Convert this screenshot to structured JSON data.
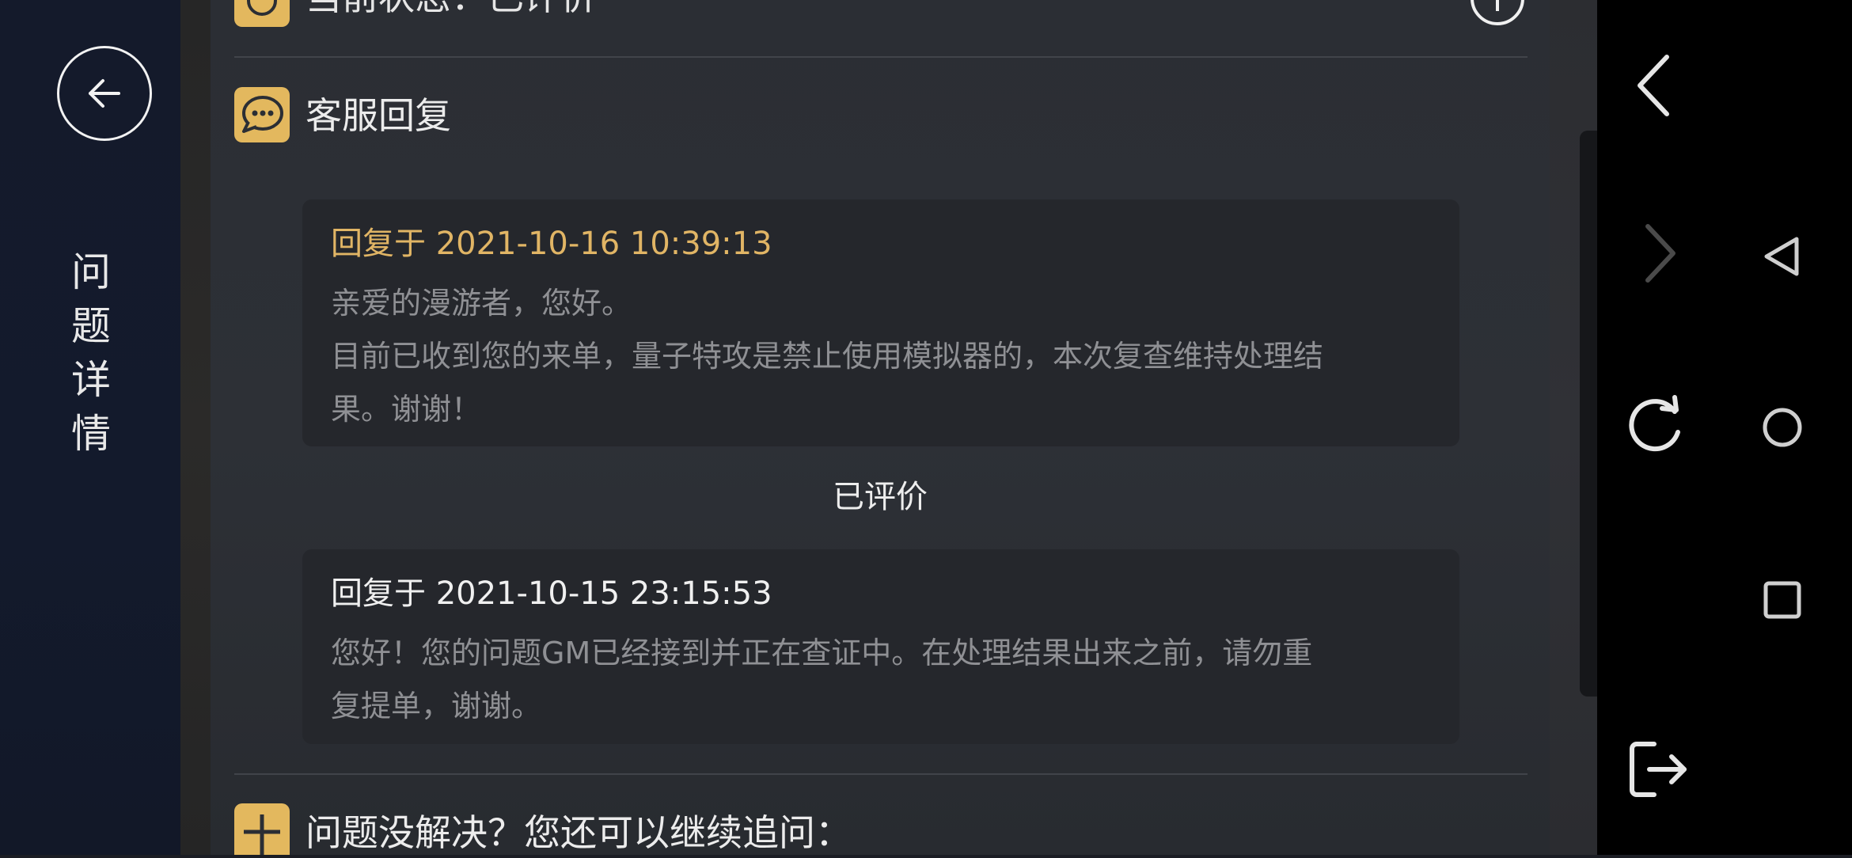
{
  "sidebar": {
    "title_chars": [
      "问",
      "题",
      "详",
      "情"
    ]
  },
  "status": {
    "text": "当前状态：已评价"
  },
  "section": {
    "title": "客服回复"
  },
  "replies": [
    {
      "time": "回复于 2021-10-16 10:39:13",
      "lines": [
        "亲爱的漫游者，您好。",
        "目前已收到您的来单，量子特攻是禁止使用模拟器的，本次复查维持处理结",
        "果。谢谢！"
      ]
    },
    {
      "time": "回复于 2021-10-15 23:15:53",
      "lines": [
        "您好！您的问题GM已经接到并正在查证中。在处理结果出来之前，请勿重",
        "复提单，谢谢。"
      ]
    }
  ],
  "rated_label": "已评价",
  "followup": {
    "text": "问题没解决？您还可以继续追问："
  },
  "colors": {
    "accent": "#e3b85e",
    "reply_time_highlight": "#e1b565"
  }
}
